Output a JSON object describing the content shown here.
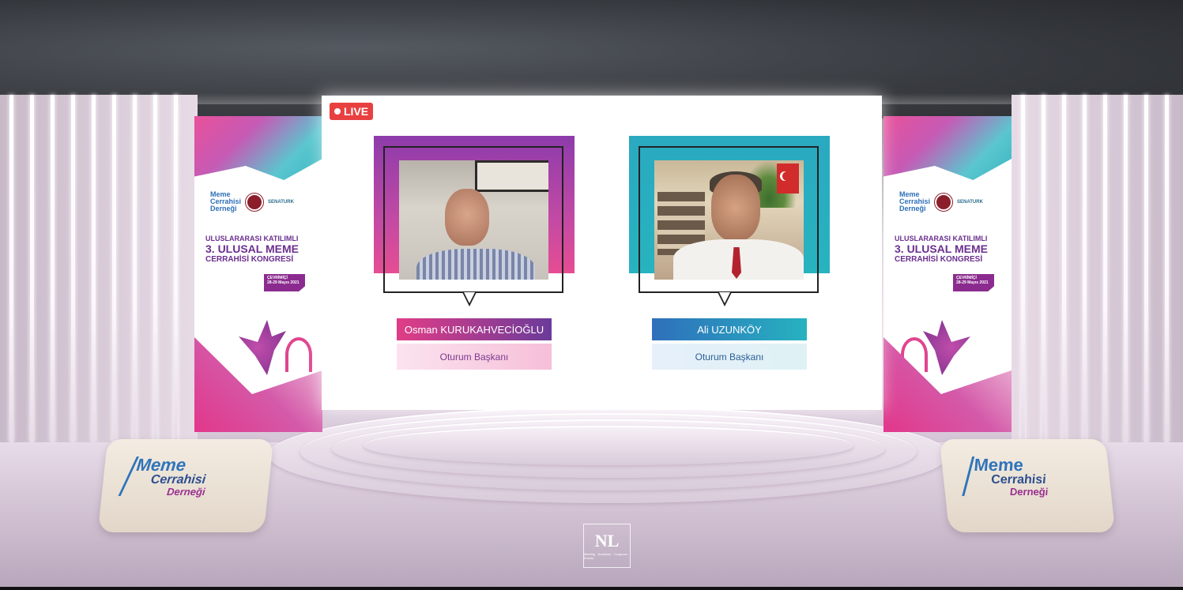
{
  "live_label": "LIVE",
  "banner": {
    "logo_main": "Meme",
    "logo_mid": "Cerrahisi",
    "logo_sub": "Derneği",
    "partner": "SENATURK",
    "title_line1": "ULUSLARARASI KATILIMLI",
    "title_line2": "3. ULUSAL MEME",
    "title_line3": "CERRAHİSİ KONGRESİ",
    "tag_line1": "ÇEVRİMİÇİ",
    "tag_line2": "28-29 Mayıs 2021"
  },
  "speakers": [
    {
      "name": "Osman KURUKAHVECİOĞLU",
      "role": "Oturum Başkanı"
    },
    {
      "name": "Ali UZUNKÖY",
      "role": "Oturum Başkanı"
    }
  ],
  "podium": {
    "line1": "Meme",
    "line2": "Cerrahisi",
    "line3": "Derneği"
  },
  "watermark": {
    "main": "NL",
    "sub": "Meeting · Academy · Congress · Events"
  },
  "colors": {
    "live": "#e84040",
    "pink": "#e13d86",
    "purple": "#6b3b9a",
    "teal": "#27b2c0",
    "blue": "#2e6fbb"
  }
}
